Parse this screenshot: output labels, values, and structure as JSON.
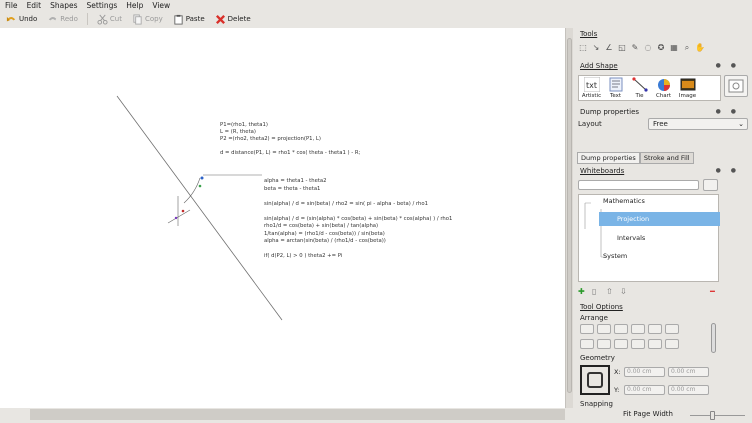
{
  "menu": [
    "File",
    "Edit",
    "Shapes",
    "Settings",
    "Help",
    "View"
  ],
  "toolbar": {
    "undo": "Undo",
    "redo": "Redo",
    "cut": "Cut",
    "copy": "Copy",
    "paste": "Paste",
    "delete": "Delete"
  },
  "canvas": {
    "block1": [
      "P1=(rho1, theta1)",
      "L = (R, theta)",
      "P2 =(rho2, theta2) = projection(P1, L)",
      "",
      "d = distance(P1, L) = rho1 * cos( theta - theta1 ) - R;"
    ],
    "block2": [
      "alpha = theta1 - theta2",
      "beta = theta - theta1",
      "",
      "sin(alpha) / d = sin(beta) / rho2 = sin( pi - alpha - beta) / rho1",
      "",
      "sin(alpha) / d = (sin(alpha) * cos(beta) + sin(beta) * cos(alpha) ) / rho1",
      "rho1/d = cos(beta) + sin(beta) / tan(alpha)",
      "1/tan(alpha) = (rho1/d - cos(beta)) / sin(beta)",
      "alpha = arctan(sin(beta) / (rho1/d - cos(beta))",
      "",
      "if( d(P2, L) > 0 ) theta2 += Pi"
    ]
  },
  "panel": {
    "tools_title": "Tools",
    "add_shape_title": "Add Shape",
    "shapes": [
      "Artistic",
      "Text",
      "Tie",
      "Chart",
      "Image"
    ],
    "dump_props_title": "Dump properties",
    "layout_label": "Layout",
    "layout_value": "Free",
    "tab_dump": "Dump properties",
    "tab_stroke": "Stroke and Fill",
    "whiteboards_title": "Whiteboards",
    "tree": {
      "root": "Mathematics",
      "selected": "Projection",
      "child2": "Intervals",
      "other": "System"
    },
    "tool_options_title": "Tool Options",
    "arrange_label": "Arrange",
    "geometry_label": "Geometry",
    "x_label": "X:",
    "y_label": "Y:",
    "x_value": "0.00 cm",
    "w_value": "0.00 cm",
    "y_value": "0.00 cm",
    "h_value": "0.00 cm",
    "snapping_label": "Snapping"
  },
  "status": {
    "zoom": "Fit Page Width"
  },
  "colors": {
    "selection": "#7ab4e6",
    "delete": "#d9302a",
    "undo": "#e0a020"
  }
}
